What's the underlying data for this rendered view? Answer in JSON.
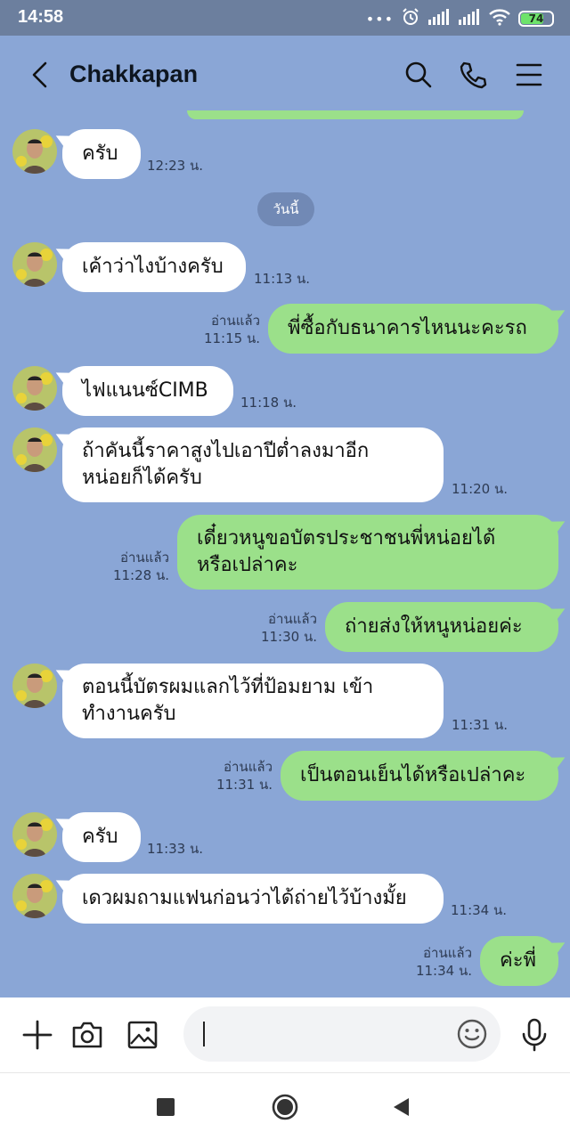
{
  "status_bar": {
    "time": "14:58",
    "dots": "•••",
    "battery": "74",
    "battery_level": 0.74
  },
  "header": {
    "contact_name": "Chakkapan"
  },
  "date_separator": "วันนี้",
  "messages": [
    {
      "text": "ครับ",
      "time": "12:23 น."
    },
    {
      "text": "เค้าว่าไงบ้างครับ",
      "time": "11:13 น."
    },
    {
      "text": "พี่ซื้อกับธนาคารไหนนะคะรถ",
      "read": "อ่านแล้ว",
      "time": "11:15 น."
    },
    {
      "text": "ไฟแนนซ์CIMB",
      "time": "11:18 น."
    },
    {
      "line1": "ถ้าคันนี้ราคาสูงไปเอาปีต่ำลงมาอีก",
      "line2": "หน่อยก็ได้ครับ",
      "time": "11:20 น."
    },
    {
      "line1": "เดี๋ยวหนูขอบัตรประชาชนพี่หน่อยได้",
      "line2": "หรือเปล่าคะ",
      "read": "อ่านแล้ว",
      "time": "11:28 น."
    },
    {
      "text": "ถ่ายส่งให้หนูหน่อยค่ะ",
      "read": "อ่านแล้ว",
      "time": "11:30 น."
    },
    {
      "line1": "ตอนนี้บัตรผมแลกไว้ที่ป้อมยาม เข้า",
      "line2": "ทำงานครับ",
      "time": "11:31 น."
    },
    {
      "text": "เป็นตอนเย็นได้หรือเปล่าคะ",
      "read": "อ่านแล้ว",
      "time": "11:31 น."
    },
    {
      "text": "ครับ",
      "time": "11:33 น."
    },
    {
      "text": "เดวผมถามแฟนก่อนว่าได้ถ่ายไว้บ้างมั้ย",
      "time": "11:34 น."
    },
    {
      "text": "ค่ะพี่",
      "read": "อ่านแล้ว",
      "time": "11:34 น."
    }
  ],
  "input": {
    "value": ""
  },
  "colors": {
    "background": "#8aa6d6",
    "outgoing_bubble": "#9be08a",
    "incoming_bubble": "#ffffff",
    "status_bar": "#6c7f9e"
  },
  "icons": {
    "header": [
      "back-arrow-icon",
      "search-icon",
      "phone-icon",
      "menu-icon"
    ],
    "input_bar": [
      "plus-icon",
      "camera-icon",
      "image-icon",
      "emoji-icon",
      "microphone-icon"
    ],
    "navigation": [
      "recent-apps-icon",
      "home-icon",
      "back-icon"
    ]
  }
}
